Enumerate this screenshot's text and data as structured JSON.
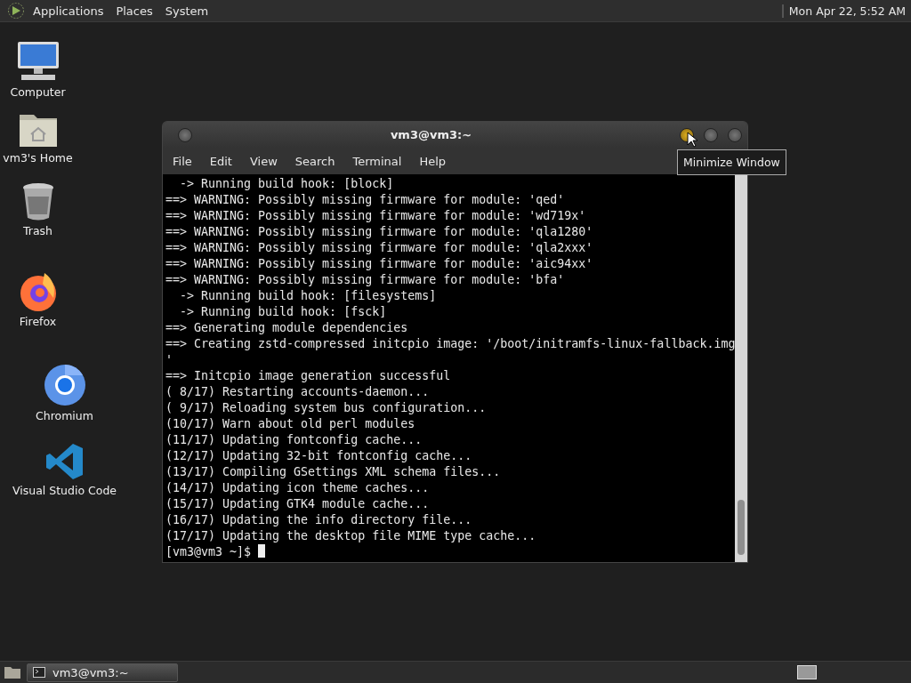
{
  "top_panel": {
    "menus": [
      "Applications",
      "Places",
      "System"
    ],
    "clock": "Mon Apr 22, 5:52 AM"
  },
  "desktop_icons": [
    {
      "kind": "computer",
      "label": "Computer"
    },
    {
      "kind": "home",
      "label": "vm3's Home"
    },
    {
      "kind": "trash",
      "label": "Trash"
    },
    {
      "kind": "firefox",
      "label": "Firefox"
    },
    {
      "kind": "chromium",
      "label": "Chromium"
    },
    {
      "kind": "vscode",
      "label": "Visual Studio Code"
    }
  ],
  "window": {
    "title": "vm3@vm3:~",
    "buttons": [
      {
        "highlighted": true
      },
      {
        "highlighted": false
      },
      {
        "highlighted": false
      }
    ],
    "menus": [
      "File",
      "Edit",
      "View",
      "Search",
      "Terminal",
      "Help"
    ],
    "lines": [
      "  -> Running build hook: [block]",
      "==> WARNING: Possibly missing firmware for module: 'qed'",
      "==> WARNING: Possibly missing firmware for module: 'wd719x'",
      "==> WARNING: Possibly missing firmware for module: 'qla1280'",
      "==> WARNING: Possibly missing firmware for module: 'qla2xxx'",
      "==> WARNING: Possibly missing firmware for module: 'aic94xx'",
      "==> WARNING: Possibly missing firmware for module: 'bfa'",
      "  -> Running build hook: [filesystems]",
      "  -> Running build hook: [fsck]",
      "==> Generating module dependencies",
      "==> Creating zstd-compressed initcpio image: '/boot/initramfs-linux-fallback.img",
      "'",
      "==> Initcpio image generation successful",
      "( 8/17) Restarting accounts-daemon...",
      "( 9/17) Reloading system bus configuration...",
      "(10/17) Warn about old perl modules",
      "(11/17) Updating fontconfig cache...",
      "(12/17) Updating 32-bit fontconfig cache...",
      "(13/17) Compiling GSettings XML schema files...",
      "(14/17) Updating icon theme caches...",
      "(15/17) Updating GTK4 module cache...",
      "(16/17) Updating the info directory file...",
      "(17/17) Updating the desktop file MIME type cache..."
    ],
    "prompt": "[vm3@vm3 ~]$ "
  },
  "tooltip": "Minimize Window",
  "taskbar": {
    "tasks": [
      {
        "label": "vm3@vm3:~",
        "selected": true
      }
    ]
  }
}
